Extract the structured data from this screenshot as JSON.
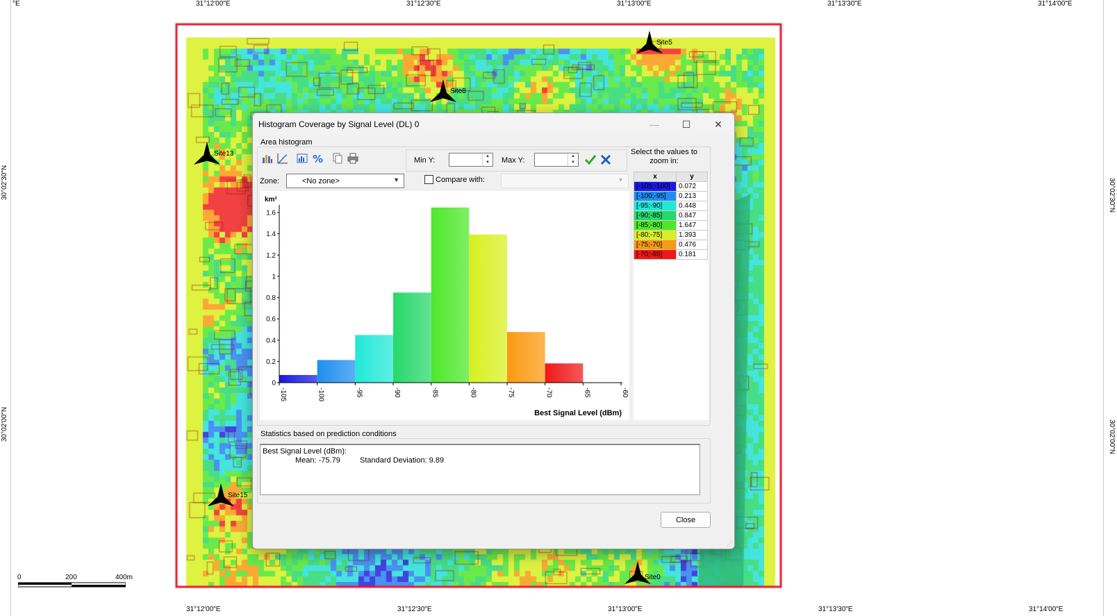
{
  "map": {
    "top_coords": [
      "°E",
      "31°12'00\"E",
      "31°12'30\"E",
      "31°13'00\"E",
      "31°13'30\"E",
      "31°14'00\"E"
    ],
    "bottom_coords": [
      "31°12'00\"E",
      "31°12'30\"E",
      "31°13'00\"E",
      "31°13'30\"E",
      "31°14'00\"E"
    ],
    "left_coords": [
      "30°02'30\"N",
      "30°02'00\"N"
    ],
    "right_coords": [
      "30°02'30\"N",
      "30°02'00\"N"
    ],
    "scale": [
      "0",
      "200",
      "400m"
    ],
    "site_labels": [
      "Site5",
      "Site8",
      "Site13",
      "Site15",
      "Site0"
    ],
    "frame_color": "#e8192c"
  },
  "dialog": {
    "title": "Histogram   Coverage by Signal Level (DL) 0",
    "window_buttons": [
      "—",
      "☐",
      "✕"
    ],
    "area_histogram_label": "Area histogram",
    "min_y_label": "Min Y:",
    "max_y_label": "Max Y:",
    "min_y_value": "",
    "max_y_value": "",
    "zoom_hint": "Select the values to zoom in:",
    "zone_label": "Zone:",
    "zone_value": "<No zone>",
    "compare_label": "Compare with:",
    "compare_value": "",
    "stats_label": "Statistics based on prediction conditions",
    "stats_metric": "Best Signal Level (dBm):",
    "stats_mean": "Mean: -75.79",
    "stats_std": "Standard Deviation: 9.89",
    "close_label": "Close"
  },
  "table": {
    "headers": [
      "x",
      "y"
    ],
    "rows": [
      {
        "x": "[-105;-100]",
        "y": "0.072",
        "color": "#1a1ae6"
      },
      {
        "x": "[-100;-95]",
        "y": "0.213",
        "color": "#1e8ef0"
      },
      {
        "x": "[-95;-90]",
        "y": "0.448",
        "color": "#22e8d8"
      },
      {
        "x": "[-90;-85]",
        "y": "0.847",
        "color": "#27d86a"
      },
      {
        "x": "[-85;-80]",
        "y": "1.647",
        "color": "#4de82a"
      },
      {
        "x": "[-80;-75]",
        "y": "1.393",
        "color": "#d8f020"
      },
      {
        "x": "[-75;-70]",
        "y": "0.476",
        "color": "#fa9a10"
      },
      {
        "x": "[-70;-65]",
        "y": "0.181",
        "color": "#f01818"
      }
    ]
  },
  "chart_data": {
    "type": "bar",
    "title": "",
    "xlabel": "Best Signal Level (dBm)",
    "ylabel": "km²",
    "x_ticks": [
      "-105",
      "-100",
      "-95",
      "-90",
      "-85",
      "-80",
      "-75",
      "-70",
      "-65",
      "-60"
    ],
    "y_ticks": [
      "0",
      "0.2",
      "0.4",
      "0.6",
      "0.8",
      "1",
      "1.2",
      "1.4",
      "1.6"
    ],
    "bin_edges": [
      -105,
      -100,
      -95,
      -90,
      -85,
      -80,
      -75,
      -70,
      -65
    ],
    "values": [
      0.072,
      0.213,
      0.448,
      0.847,
      1.647,
      1.393,
      0.476,
      0.181
    ],
    "colors": [
      "#1a1ae6",
      "#1e8ef0",
      "#22e8d8",
      "#27d86a",
      "#4de82a",
      "#d8f020",
      "#fa9a10",
      "#f01818"
    ],
    "xlim": [
      -105,
      -60
    ],
    "ylim": [
      0,
      1.6
    ],
    "grid": false
  }
}
